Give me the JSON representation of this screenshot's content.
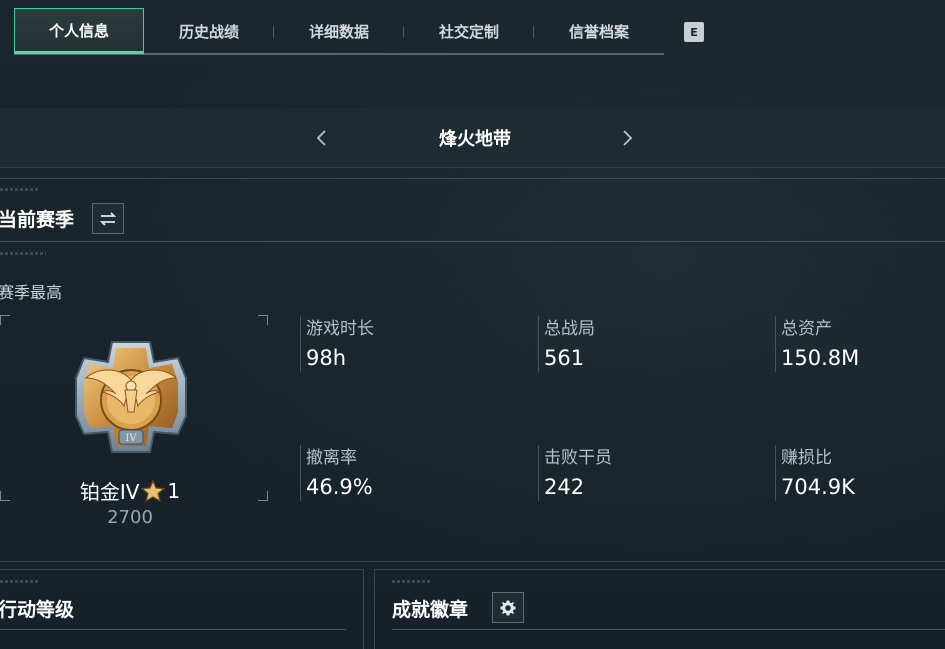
{
  "tabs": [
    {
      "label": "个人信息",
      "active": true
    },
    {
      "label": "历史战绩",
      "active": false
    },
    {
      "label": "详细数据",
      "active": false
    },
    {
      "label": "社交定制",
      "active": false
    },
    {
      "label": "信誉档案",
      "active": false
    }
  ],
  "tab_hotkey": "E",
  "mode": {
    "title": "烽火地带",
    "prev_icon": "chevron-left-icon",
    "next_icon": "chevron-right-icon"
  },
  "season": {
    "title": "当前赛季",
    "swap_icon": "swap-icon",
    "best_label": "赛季最高",
    "rank": {
      "name": "铂金IV",
      "stars": "1",
      "star_icon": "star-icon",
      "score": "2700",
      "medal_icon": "platinum-eagle-medal-icon"
    },
    "stats": [
      {
        "label": "游戏时长",
        "value": "98h"
      },
      {
        "label": "总战局",
        "value": "561"
      },
      {
        "label": "总资产",
        "value": "150.8M"
      },
      {
        "label": "撤离率",
        "value": "46.9%"
      },
      {
        "label": "击败干员",
        "value": "242"
      },
      {
        "label": "赚损比",
        "value": "704.9K"
      }
    ]
  },
  "bottom_panels": {
    "action_level": {
      "title": "行动等级"
    },
    "badges": {
      "title": "成就徽章",
      "settings_icon": "gear-icon"
    }
  },
  "colors": {
    "accent": "#3fe0a0",
    "background": "#17212a",
    "medal_gold": "#c98a3a"
  }
}
